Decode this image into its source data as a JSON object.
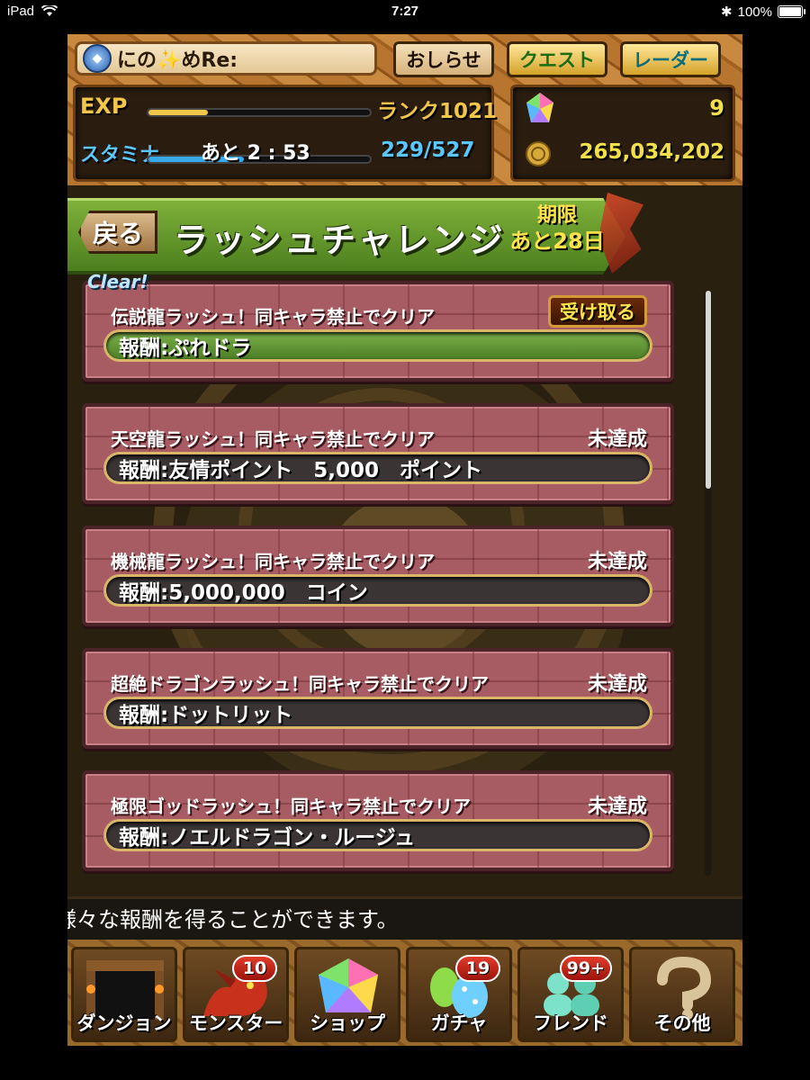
{
  "status_bar": {
    "device": "iPad",
    "time": "7:27",
    "battery": "100%",
    "battery_level": 1.0
  },
  "header": {
    "player_name": "にの✨めRe:",
    "buttons": {
      "news": "おしらせ",
      "quest": "クエスト",
      "radar": "レーダー"
    },
    "exp_label": "EXP",
    "exp_progress": 0.27,
    "rank": "ランク1021",
    "stamina_label": "スタミナ",
    "stamina_progress": 0.43,
    "stamina_timer": "あと 2 : 53",
    "stamina_value": "229/527",
    "magic_stones": "9",
    "coins": "265,034,202",
    "colors": {
      "exp": "#f2c648",
      "stamina": "#37a9ea",
      "stamina_text": "#5ac7ff"
    }
  },
  "page": {
    "back_button": "戻る",
    "title": "ラッシュチャレンジ",
    "deadline_label": "期限",
    "deadline_value": "あと28日",
    "clear_label": "Clear!"
  },
  "challenges": [
    {
      "title": "伝説龍ラッシュ！同キャラ禁止でクリア",
      "status": "",
      "action": "受け取る",
      "reward": "報酬:ぷれドラ",
      "cleared": true
    },
    {
      "title": "天空龍ラッシュ！同キャラ禁止でクリア",
      "status": "未達成",
      "action": "",
      "reward": "報酬:友情ポイント　5,000　ポイント",
      "cleared": false
    },
    {
      "title": "機械龍ラッシュ！同キャラ禁止でクリア",
      "status": "未達成",
      "action": "",
      "reward": "報酬:5,000,000　コイン",
      "cleared": false
    },
    {
      "title": "超絶ドラゴンラッシュ！同キャラ禁止でクリア",
      "status": "未達成",
      "action": "",
      "reward": "報酬:ドットリット",
      "cleared": false
    },
    {
      "title": "極限ゴッドラッシュ！同キャラ禁止でクリア",
      "status": "未達成",
      "action": "",
      "reward": "報酬:ノエルドラゴン・ルージュ",
      "cleared": false
    }
  ],
  "message": "様々な報酬を得ることができます。",
  "nav": [
    {
      "label": "ダンジョン",
      "icon": "dungeon-gate-icon",
      "badge": ""
    },
    {
      "label": "モンスター",
      "icon": "dragon-icon",
      "badge": "10"
    },
    {
      "label": "ショップ",
      "icon": "gem-icon",
      "badge": ""
    },
    {
      "label": "ガチャ",
      "icon": "egg-icon",
      "badge": "19"
    },
    {
      "label": "フレンド",
      "icon": "friends-icon",
      "badge": "99+"
    },
    {
      "label": "その他",
      "icon": "question-mark-icon",
      "badge": ""
    }
  ]
}
